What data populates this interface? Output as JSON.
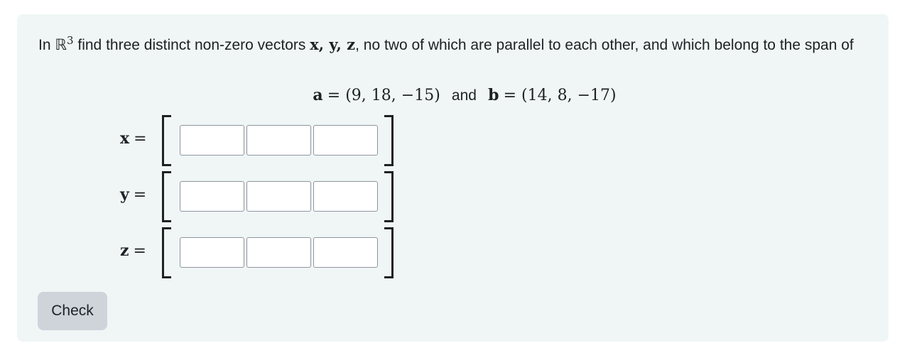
{
  "question": {
    "prefix": "In ",
    "space_symbol": "ℝ",
    "space_exponent": "3",
    "middle": " find three distinct non-zero vectors ",
    "vectors_list": "x, y, z",
    "suffix": ", no two of which are parallel to each other, and which belong to the span of"
  },
  "span_vectors": {
    "a_name": "a",
    "a_value": "= (9, 18, −15)",
    "connector": "and",
    "b_name": "b",
    "b_value": "= (14, 8, −17)"
  },
  "answer_rows": [
    {
      "label": "x",
      "equals": "=",
      "values": [
        "",
        "",
        ""
      ]
    },
    {
      "label": "y",
      "equals": "=",
      "values": [
        "",
        "",
        ""
      ]
    },
    {
      "label": "z",
      "equals": "=",
      "values": [
        "",
        "",
        ""
      ]
    }
  ],
  "check_button": {
    "label": "Check"
  },
  "colors": {
    "card_background": "#f0f6f6",
    "button_background": "#ced4da",
    "text": "#1d2125",
    "input_border": "#8f959e"
  }
}
